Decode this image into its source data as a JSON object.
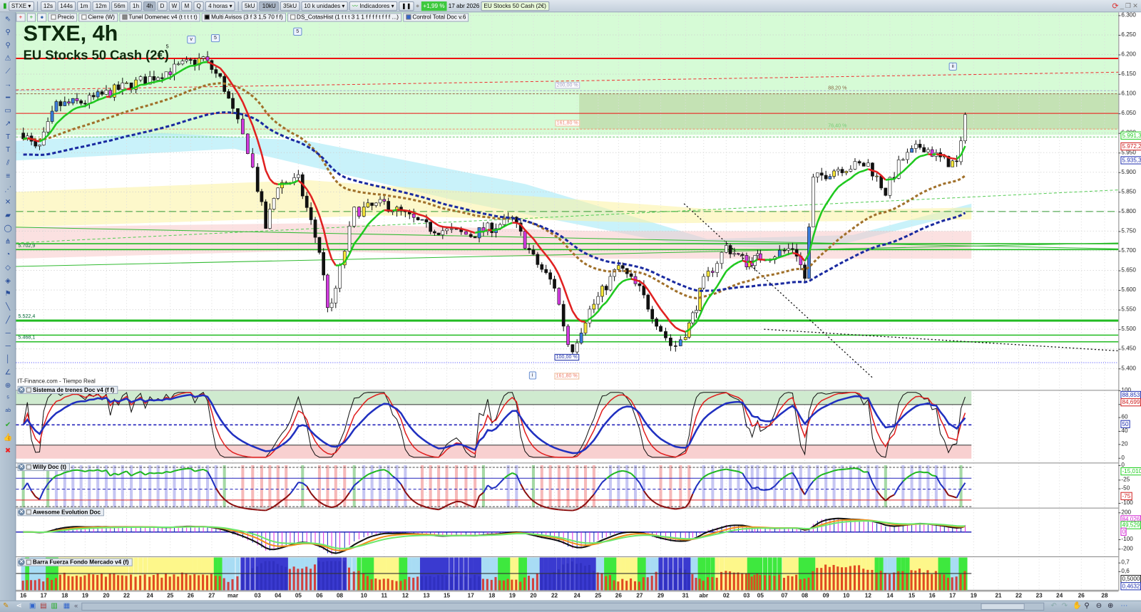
{
  "toolbar": {
    "symbol": "STXE",
    "timeframes": [
      "12s",
      "144s",
      "1m",
      "12m",
      "56m",
      "1h",
      "4h",
      "D",
      "W",
      "M",
      "Q"
    ],
    "active_timeframe": "4h",
    "period_select": "4 horas",
    "units": [
      "5kU",
      "10kU",
      "35kU"
    ],
    "active_unit": "10kU",
    "units_select": "10 k unidades",
    "indicators_label": "Indicadores",
    "change": "+1,99 %",
    "date": "17 abr 2026",
    "instrument": "EU Stocks 50 Cash (2€)"
  },
  "tags": [
    "Precio",
    "Cierre (W)",
    "Tunel Domenec v4 (t t t t t)",
    "Multi Avisos (3 f 3 1,5 70 f f)",
    "DS_CotasHist (1 t t t 3 1 1 f f f f t f f f ...)",
    "Control Total Doc v.6"
  ],
  "chart": {
    "title": "STXE, 4h",
    "subtitle": "EU Stocks 50 Cash (2€)",
    "source": "IT-Finance.com - Tiempo Real",
    "level_labels": [
      "5.702,9",
      "5.522,4",
      "5.468,1"
    ],
    "fib_labels": [
      "200,00 %",
      "161,80 %",
      "88,20 %",
      "76,40 %",
      "100,00 %",
      "161,80 %"
    ],
    "wave_labels": [
      "v",
      "5",
      "5",
      "5",
      "i",
      "ii"
    ]
  },
  "price_axis": {
    "ticks": [
      "6.300",
      "6.250",
      "6.200",
      "6.150",
      "6.100",
      "6.050",
      "6.000",
      "5.950",
      "5.900",
      "5.850",
      "5.800",
      "5.750",
      "5.700",
      "5.650",
      "5.600",
      "5.550",
      "5.500",
      "5.450",
      "5.400"
    ],
    "badges": [
      {
        "text": "5.991,3",
        "color": "#1fcf1f"
      },
      {
        "text": "5.972,2",
        "color": "#d02020"
      },
      {
        "text": "5.935,3",
        "color": "#2030b0"
      }
    ]
  },
  "panes": [
    {
      "title": "Sistema de trenes Doc v4 (f f)",
      "ticks": [
        "100",
        "80",
        "60",
        "40",
        "20",
        "0"
      ],
      "badges": [
        {
          "text": "88,853",
          "color": "#2030b0"
        },
        {
          "text": "84,699",
          "color": "#d02020"
        },
        {
          "text": "50",
          "color": "#2030b0"
        }
      ]
    },
    {
      "title": "Willy Doc (t)",
      "ticks": [
        "0",
        "-25",
        "-50",
        "-100"
      ],
      "badges": [
        {
          "text": "-15,010",
          "color": "#1fcf1f"
        },
        {
          "text": "-75",
          "color": "#d02020"
        }
      ]
    },
    {
      "title": "Awesome Evolution Doc",
      "ticks": [
        "200",
        "-100",
        "-200"
      ],
      "badges": [
        {
          "text": "84,026",
          "color": "#d020d0"
        },
        {
          "text": "49,529",
          "color": "#1fcf1f"
        },
        {
          "text": "0",
          "color": "#d020d0"
        }
      ]
    },
    {
      "title": "Barra Fuerza Fondo Mercado v4 (f)",
      "ticks": [
        "0,7",
        "0,6"
      ],
      "badges": [
        {
          "text": "0,5000",
          "color": "#222"
        },
        {
          "text": "0,4632",
          "color": "#2030b0"
        }
      ]
    }
  ],
  "x_axis": [
    "16",
    "17",
    "18",
    "19",
    "20",
    "22",
    "24",
    "25",
    "26",
    "27",
    "mar",
    "03",
    "04",
    "05",
    "06",
    "08",
    "10",
    "11",
    "12",
    "13",
    "15",
    "17",
    "18",
    "19",
    "20",
    "22",
    "24",
    "25",
    "26",
    "27",
    "29",
    "31",
    "abr",
    "02",
    "03",
    "05",
    "07",
    "08",
    "09",
    "10",
    "12",
    "14",
    "15",
    "16",
    "17",
    "19",
    "21",
    "22",
    "23",
    "24",
    "26",
    "28"
  ],
  "chart_data": {
    "type": "candlestick",
    "ylim": [
      5.375,
      6.31
    ],
    "path": [
      [
        0,
        6.0
      ],
      [
        0.7,
        5.95
      ],
      [
        1.6,
        6.07
      ],
      [
        3,
        6.08
      ],
      [
        5,
        6.12
      ],
      [
        7.5,
        6.17
      ],
      [
        8.6,
        6.19
      ],
      [
        9.5,
        6.13
      ],
      [
        10.6,
        5.96
      ],
      [
        11.4,
        5.76
      ],
      [
        12,
        5.87
      ],
      [
        13,
        5.88
      ],
      [
        14,
        5.7
      ],
      [
        14.5,
        5.53
      ],
      [
        15.6,
        5.8
      ],
      [
        17,
        5.82
      ],
      [
        19,
        5.76
      ],
      [
        21,
        5.74
      ],
      [
        23,
        5.78
      ],
      [
        24,
        5.68
      ],
      [
        25,
        5.61
      ],
      [
        25.7,
        5.44
      ],
      [
        26.5,
        5.54
      ],
      [
        28,
        5.66
      ],
      [
        29,
        5.6
      ],
      [
        30,
        5.5
      ],
      [
        30.5,
        5.45
      ],
      [
        31.3,
        5.52
      ],
      [
        32,
        5.62
      ],
      [
        33,
        5.71
      ],
      [
        34,
        5.67
      ],
      [
        35.5,
        5.69
      ],
      [
        36.5,
        5.71
      ],
      [
        37,
        5.63
      ],
      [
        37.4,
        5.88
      ],
      [
        38.5,
        5.91
      ],
      [
        40,
        5.92
      ],
      [
        40.8,
        5.85
      ],
      [
        41.5,
        5.93
      ],
      [
        42.5,
        5.97
      ],
      [
        43.5,
        5.93
      ],
      [
        44.3,
        5.92
      ],
      [
        44.6,
        6.06
      ],
      [
        44.8,
        6.03
      ]
    ],
    "levels": [
      6.19,
      6.05,
      5.99,
      5.855,
      5.8,
      5.718,
      5.703,
      5.522,
      5.485,
      5.468
    ]
  }
}
